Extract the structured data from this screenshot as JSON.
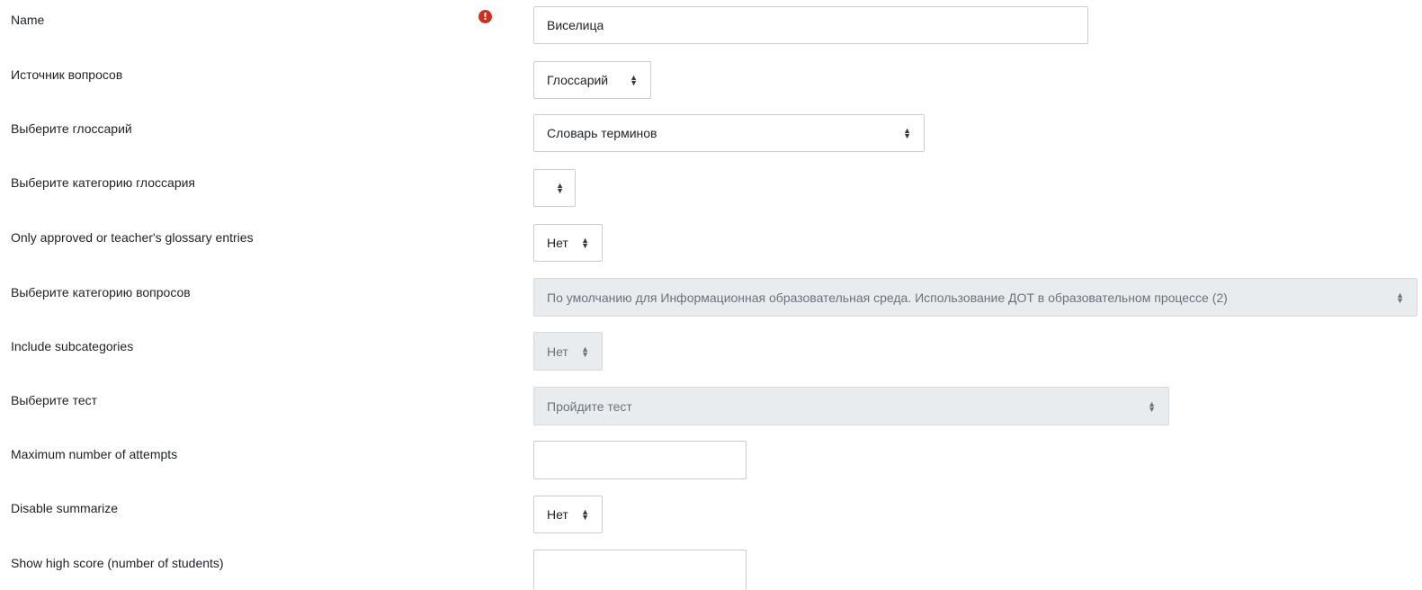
{
  "form": {
    "name": {
      "label": "Name",
      "value": "Виселица",
      "required": true
    },
    "question_source": {
      "label": "Источник вопросов",
      "selected": "Глоссарий"
    },
    "glossary": {
      "label": "Выберите глоссарий",
      "selected": "Словарь терминов"
    },
    "glossary_category": {
      "label": "Выберите категорию глоссария",
      "selected": ""
    },
    "only_approved": {
      "label": "Only approved or teacher's glossary entries",
      "selected": "Нет"
    },
    "question_category": {
      "label": "Выберите категорию вопросов",
      "selected": "По умолчанию для Информационная образовательная среда. Использование ДОТ в образовательном процессе (2)",
      "disabled": true
    },
    "include_subcategories": {
      "label": "Include subcategories",
      "selected": "Нет",
      "disabled": true
    },
    "quiz": {
      "label": "Выберите тест",
      "selected": "Пройдите тест",
      "disabled": true
    },
    "max_attempts": {
      "label": "Maximum number of attempts",
      "value": ""
    },
    "disable_summarize": {
      "label": "Disable summarize",
      "selected": "Нет"
    },
    "high_score": {
      "label": "Show high score (number of students)",
      "value": ""
    }
  },
  "icons": {
    "required": "exclamation-circle-icon",
    "select_arrows": "sort-arrows-icon"
  },
  "colors": {
    "required_icon": "#ca3120",
    "disabled_bg": "#e9ecef",
    "border": "#c9cdd1"
  }
}
